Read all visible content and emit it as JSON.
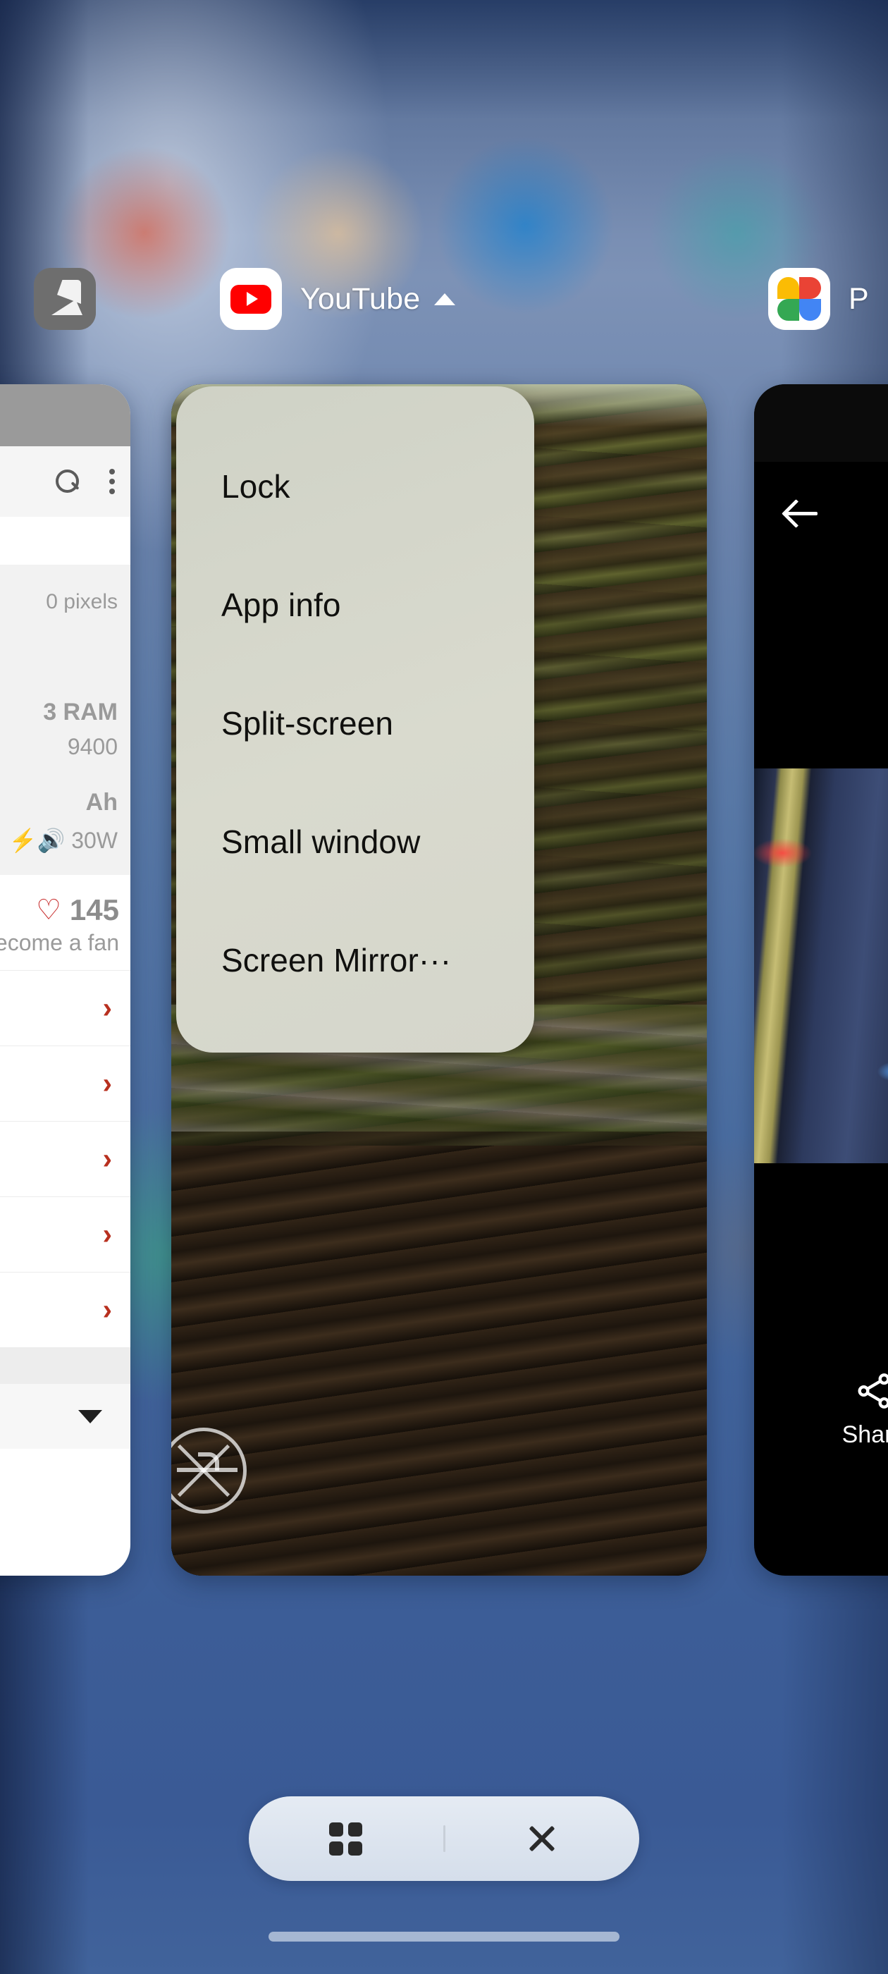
{
  "screen": {
    "name": "recent-apps-overview",
    "active_app_title": "YouTube",
    "caret_up_icon": "caret-up-icon"
  },
  "app_headers": [
    {
      "icon": "antutu-icon",
      "label": ""
    },
    {
      "icon": "youtube-icon",
      "label": "YouTube"
    },
    {
      "icon": "google-photos-icon",
      "label": "P"
    }
  ],
  "task_menu": {
    "items": [
      {
        "label": "Lock",
        "name": "menu-item-lock"
      },
      {
        "label": "App info",
        "name": "menu-item-app-info"
      },
      {
        "label": "Split-screen",
        "name": "menu-item-split-screen"
      },
      {
        "label": "Small window",
        "name": "menu-item-small-window"
      },
      {
        "label": "Screen Mirror···",
        "name": "menu-item-screen-mirror"
      }
    ]
  },
  "left_card": {
    "app": "AnTuTu Benchmark",
    "search_icon": "search-icon",
    "overflow_icon": "more-vertical-icon",
    "specs": {
      "resolution": "0 pixels",
      "ram": "3 RAM",
      "chipset": "9400",
      "battery": "Ah",
      "charging": "30W",
      "charging_icon": "fast-charge-icon"
    },
    "fan": {
      "heart_icon": "heart-icon",
      "count": "145",
      "label": "Become a fan"
    },
    "rows_count": 5,
    "row_chevron_icon": "chevron-right-icon",
    "footer_caret_icon": "caret-down-icon"
  },
  "center_card": {
    "app": "YouTube",
    "content": "forest redwood trees video frame",
    "watermark_icon": "crossed-arrows-circle-watermark-icon"
  },
  "right_card": {
    "app": "Google Photos",
    "back_icon": "arrow-left-icon",
    "content": "night tram photo",
    "share": {
      "icon": "share-icon",
      "label": "Share"
    }
  },
  "action_bar": {
    "grid_button": {
      "icon": "grid-icon",
      "name": "app-grid-button"
    },
    "separator": "|",
    "close_button": {
      "icon": "close-x-icon",
      "name": "clear-all-button"
    }
  },
  "navigation": {
    "home_indicator": "home-indicator"
  },
  "colors": {
    "accent_red": "#ff0000",
    "menu_bg": "#d4d6cb",
    "chevron_red": "#b8301f",
    "heart_red": "#c62828",
    "wallpaper_blue": "#41639b"
  }
}
